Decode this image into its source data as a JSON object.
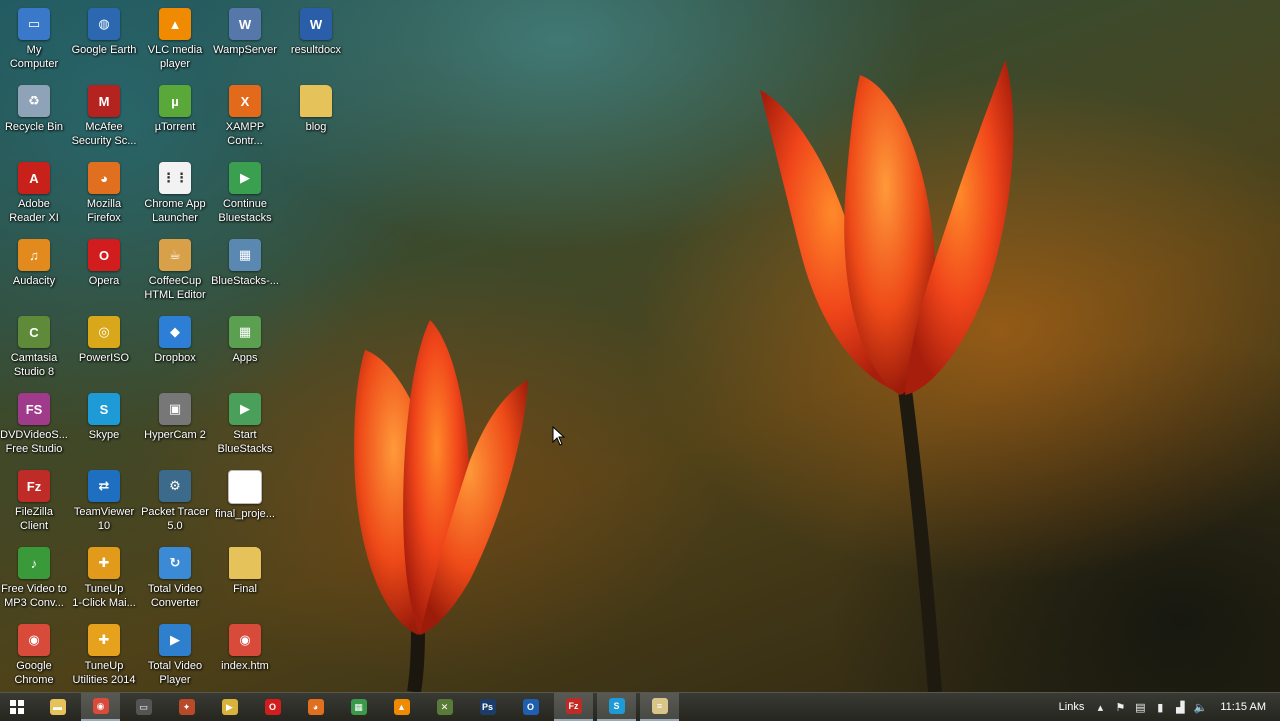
{
  "desktop": {
    "icons": [
      {
        "label": "My\nComputer",
        "icon": "computer-icon",
        "color": "#3a79c9",
        "glyph": "▭"
      },
      {
        "label": "Recycle Bin",
        "icon": "recycle-bin-icon",
        "color": "#8fa3b8",
        "glyph": "♻"
      },
      {
        "label": "Adobe\nReader XI",
        "icon": "adobe-reader-icon",
        "color": "#c8201a",
        "glyph": "A"
      },
      {
        "label": "Audacity",
        "icon": "audacity-icon",
        "color": "#e28a1e",
        "glyph": "♫"
      },
      {
        "label": "Camtasia\nStudio 8",
        "icon": "camtasia-icon",
        "color": "#5e8a3a",
        "glyph": "C"
      },
      {
        "label": "DVDVideoS...\nFree Studio",
        "icon": "dvdvideosoft-icon",
        "color": "#a03a8a",
        "glyph": "FS"
      },
      {
        "label": "FileZilla\nClient",
        "icon": "filezilla-icon",
        "color": "#bf2b26",
        "glyph": "Fz"
      },
      {
        "label": "Free Video to\nMP3 Conv...",
        "icon": "free-video-to-mp3-icon",
        "color": "#3a9a3a",
        "glyph": "♪"
      },
      {
        "label": "Google\nChrome",
        "icon": "chrome-icon",
        "color": "#d84b3a",
        "glyph": "◉"
      },
      {
        "label": "Google Earth",
        "icon": "google-earth-icon",
        "color": "#2b68b0",
        "glyph": "◍"
      },
      {
        "label": "McAfee\nSecurity Sc...",
        "icon": "mcafee-icon",
        "color": "#b4231f",
        "glyph": "M"
      },
      {
        "label": "Mozilla\nFirefox",
        "icon": "firefox-icon",
        "color": "#e07020",
        "glyph": "◕"
      },
      {
        "label": "Opera",
        "icon": "opera-icon",
        "color": "#d11d1d",
        "glyph": "O"
      },
      {
        "label": "PowerISO",
        "icon": "poweriso-icon",
        "color": "#d8a81a",
        "glyph": "◎"
      },
      {
        "label": "Skype",
        "icon": "skype-icon",
        "color": "#1e9ad6",
        "glyph": "S"
      },
      {
        "label": "TeamViewer\n10",
        "icon": "teamviewer-icon",
        "color": "#1f6fc0",
        "glyph": "⇄"
      },
      {
        "label": "TuneUp\n1-Click Mai...",
        "icon": "tuneup-oneclick-icon",
        "color": "#e29a1a",
        "glyph": "✚"
      },
      {
        "label": "TuneUp\nUtilities 2014",
        "icon": "tuneup-utilities-icon",
        "color": "#e6a21c",
        "glyph": "✚"
      },
      {
        "label": "VLC media\nplayer",
        "icon": "vlc-icon",
        "color": "#f08a00",
        "glyph": "▲"
      },
      {
        "label": "µTorrent",
        "icon": "utorrent-icon",
        "color": "#5aa83a",
        "glyph": "µ"
      },
      {
        "label": "Chrome App\nLauncher",
        "icon": "chrome-app-launcher-icon",
        "color": "#f2f2f2",
        "glyph": "⋮⋮"
      },
      {
        "label": "CoffeeCup\nHTML Editor",
        "icon": "coffeecup-icon",
        "color": "#d9a04a",
        "glyph": "☕"
      },
      {
        "label": "Dropbox",
        "icon": "dropbox-icon",
        "color": "#2d7fd6",
        "glyph": "◆"
      },
      {
        "label": "HyperCam 2",
        "icon": "hypercam-icon",
        "color": "#777777",
        "glyph": "▣"
      },
      {
        "label": "Packet Tracer\n5.0",
        "icon": "packet-tracer-icon",
        "color": "#3c6a8a",
        "glyph": "⚙"
      },
      {
        "label": "Total Video\nConverter",
        "icon": "total-video-converter-icon",
        "color": "#3a8ad6",
        "glyph": "↻"
      },
      {
        "label": "Total Video\nPlayer",
        "icon": "total-video-player-icon",
        "color": "#2f7fcf",
        "glyph": "▶"
      },
      {
        "label": "WampServer",
        "icon": "wampserver-icon",
        "color": "#5577aa",
        "glyph": "W"
      },
      {
        "label": "XAMPP\nContr...",
        "icon": "xampp-icon",
        "color": "#e36a1a",
        "glyph": "X"
      },
      {
        "label": "Continue\nBluestacks",
        "icon": "bluestacks-continue-icon",
        "color": "#3aa050",
        "glyph": "▶"
      },
      {
        "label": "BlueStacks-...",
        "icon": "bluestacks-icon",
        "color": "#5a88b0",
        "glyph": "▦"
      },
      {
        "label": "Apps",
        "icon": "apps-icon",
        "color": "#5aa050",
        "glyph": "▦"
      },
      {
        "label": "Start\nBlueStacks",
        "icon": "start-bluestacks-icon",
        "color": "#4aa05a",
        "glyph": "▶"
      },
      {
        "label": "final_proje...",
        "icon": "file-icon",
        "color": "#ffffff",
        "glyph": ""
      },
      {
        "label": "Final",
        "icon": "folder-icon",
        "color": "#e6c25a",
        "glyph": ""
      },
      {
        "label": "index.htm",
        "icon": "chrome-html-icon",
        "color": "#d84b3a",
        "glyph": "◉"
      },
      {
        "label": "resultdocx",
        "icon": "word-doc-icon",
        "color": "#2b5ea8",
        "glyph": "W"
      },
      {
        "label": "blog",
        "icon": "folder-icon",
        "color": "#e6c25a",
        "glyph": ""
      }
    ]
  },
  "taskbar": {
    "buttons": [
      {
        "name": "file-explorer",
        "icon": "folder-icon",
        "color": "#e6c25a",
        "glyph": "▬"
      },
      {
        "name": "chrome",
        "icon": "chrome-icon",
        "color": "#d84b3a",
        "glyph": "◉",
        "active": true
      },
      {
        "name": "window-app",
        "icon": "window-icon",
        "color": "#555555",
        "glyph": "▭"
      },
      {
        "name": "red-app",
        "icon": "app-icon",
        "color": "#b84a2a",
        "glyph": "✦"
      },
      {
        "name": "media-app",
        "icon": "media-icon",
        "color": "#d8b23a",
        "glyph": "▶"
      },
      {
        "name": "opera",
        "icon": "opera-icon",
        "color": "#d11d1d",
        "glyph": "O"
      },
      {
        "name": "firefox",
        "icon": "firefox-icon",
        "color": "#e07020",
        "glyph": "◕"
      },
      {
        "name": "spreadsheet",
        "icon": "spreadsheet-icon",
        "color": "#3a9a4a",
        "glyph": "▦"
      },
      {
        "name": "vlc",
        "icon": "vlc-icon",
        "color": "#f08a00",
        "glyph": "▲"
      },
      {
        "name": "tool-app",
        "icon": "tool-icon",
        "color": "#5a7a3a",
        "glyph": "✕"
      },
      {
        "name": "photoshop",
        "icon": "photoshop-icon",
        "color": "#1c3c6a",
        "glyph": "Ps"
      },
      {
        "name": "outlook",
        "icon": "outlook-icon",
        "color": "#1f5fb0",
        "glyph": "O"
      },
      {
        "name": "filezilla",
        "icon": "filezilla-icon",
        "color": "#bf2b26",
        "glyph": "Fz",
        "active": true
      },
      {
        "name": "skype",
        "icon": "skype-icon",
        "color": "#1e9ad6",
        "glyph": "S",
        "active": true
      },
      {
        "name": "notepad",
        "icon": "notepad-icon",
        "color": "#d9c48a",
        "glyph": "≡",
        "active": true
      }
    ],
    "tray": {
      "links_label": "Links",
      "icons": [
        {
          "name": "chevron-up-icon",
          "glyph": "▴"
        },
        {
          "name": "flag-icon",
          "glyph": "⚑"
        },
        {
          "name": "network-icon",
          "glyph": "▤"
        },
        {
          "name": "battery-icon",
          "glyph": "▮"
        },
        {
          "name": "signal-icon",
          "glyph": "▟"
        },
        {
          "name": "volume-icon",
          "glyph": "🔈"
        }
      ],
      "time": "11:15 AM"
    }
  }
}
